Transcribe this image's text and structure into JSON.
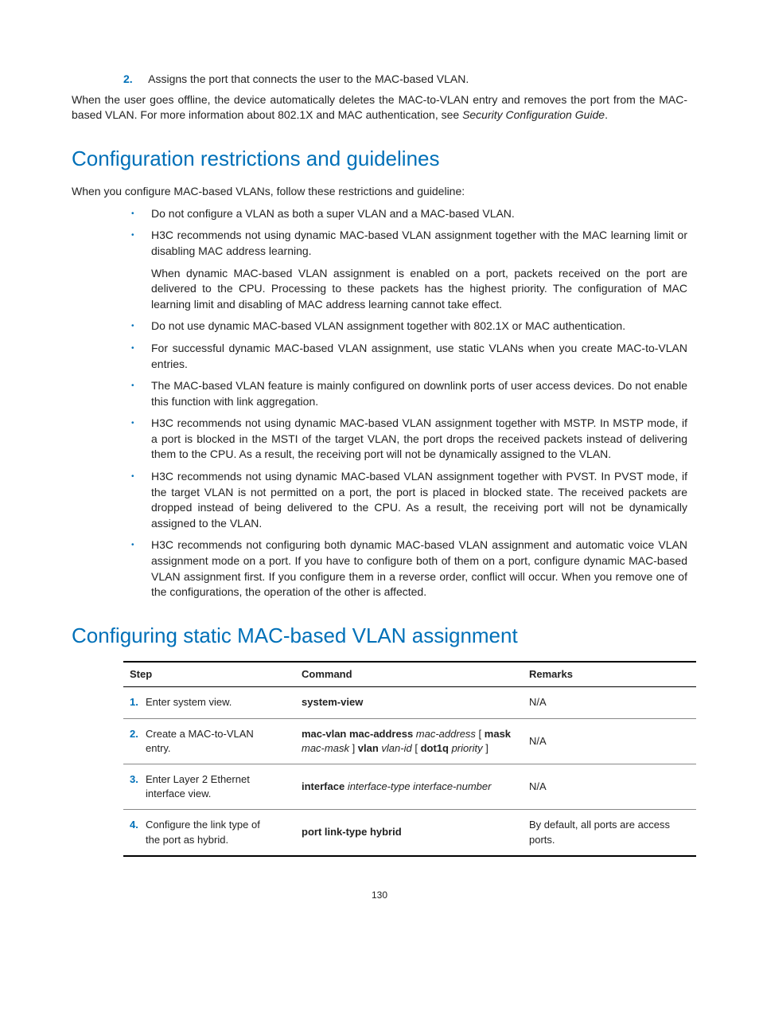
{
  "ordered": {
    "num": "2.",
    "text": "Assigns the port that connects the user to the MAC-based VLAN."
  },
  "intro_para": {
    "a": "When the user goes offline, the device automatically deletes the MAC-to-VLAN entry and removes the port from the MAC-based VLAN. For more information about 802.1X and MAC authentication, see ",
    "b": "Security Configuration Guide",
    "c": "."
  },
  "h1": "Configuration restrictions and guidelines",
  "h1_intro": "When you configure MAC-based VLANs, follow these restrictions and guideline:",
  "bullets": [
    {
      "text": "Do not configure a VLAN as both a super VLAN and a MAC-based VLAN."
    },
    {
      "text": "H3C recommends not using dynamic MAC-based VLAN assignment together with the MAC learning limit or disabling MAC address learning.",
      "sub": "When dynamic MAC-based VLAN assignment is enabled on a port, packets received on the port are delivered to the CPU. Processing to these packets has the highest priority. The configuration of MAC learning limit and disabling of MAC address learning cannot take effect."
    },
    {
      "text": "Do not use dynamic MAC-based VLAN assignment together with 802.1X or MAC authentication."
    },
    {
      "text": "For successful dynamic MAC-based VLAN assignment, use static VLANs when you create MAC-to-VLAN entries."
    },
    {
      "text": "The MAC-based VLAN feature is mainly configured on downlink ports of user access devices. Do not enable this function with link aggregation."
    },
    {
      "text": "H3C recommends not using dynamic MAC-based VLAN assignment together with MSTP. In MSTP mode, if a port is blocked in the MSTI of the target VLAN, the port drops the received packets instead of delivering them to the CPU. As a result, the receiving port will not be dynamically assigned to the VLAN."
    },
    {
      "text": "H3C recommends not using dynamic MAC-based VLAN assignment together with PVST. In PVST mode, if the target VLAN is not permitted on a port, the port is placed in blocked state. The received packets are dropped instead of being delivered to the CPU. As a result, the receiving port will not be dynamically assigned to the VLAN."
    },
    {
      "text": "H3C recommends not configuring both dynamic MAC-based VLAN assignment and automatic voice VLAN assignment mode on a port. If you have to configure both of them on a port, configure dynamic MAC-based VLAN assignment first. If you configure them in a reverse order, conflict will occur. When you remove one of the configurations, the operation of the other is affected."
    }
  ],
  "h2": "Configuring static MAC-based VLAN assignment",
  "table": {
    "headers": {
      "step": "Step",
      "cmd": "Command",
      "rem": "Remarks"
    },
    "rows": [
      {
        "n": "1.",
        "step": "Enter system view.",
        "cmd_parts": [
          {
            "t": "system-view",
            "b": true
          }
        ],
        "rem": "N/A"
      },
      {
        "n": "2.",
        "step": "Create a MAC-to-VLAN entry.",
        "cmd_parts": [
          {
            "t": "mac-vlan mac-address ",
            "b": true
          },
          {
            "t": "mac-address",
            "i": true
          },
          {
            "t": " [ "
          },
          {
            "t": "mask ",
            "b": true
          },
          {
            "t": "mac-mask",
            "i": true
          },
          {
            "t": " ] "
          },
          {
            "t": "vlan ",
            "b": true
          },
          {
            "t": "vlan-id",
            "i": true
          },
          {
            "t": " [ "
          },
          {
            "t": "dot1q ",
            "b": true
          },
          {
            "t": "priority",
            "i": true
          },
          {
            "t": " ]"
          }
        ],
        "rem": "N/A"
      },
      {
        "n": "3.",
        "step": "Enter Layer 2 Ethernet interface view.",
        "cmd_parts": [
          {
            "t": "interface ",
            "b": true
          },
          {
            "t": "interface-type interface-number",
            "i": true
          }
        ],
        "rem": "N/A"
      },
      {
        "n": "4.",
        "step": "Configure the link type of the port as hybrid.",
        "cmd_parts": [
          {
            "t": "port link-type hybrid",
            "b": true
          }
        ],
        "rem": "By default, all ports are access ports."
      }
    ]
  },
  "page": "130"
}
